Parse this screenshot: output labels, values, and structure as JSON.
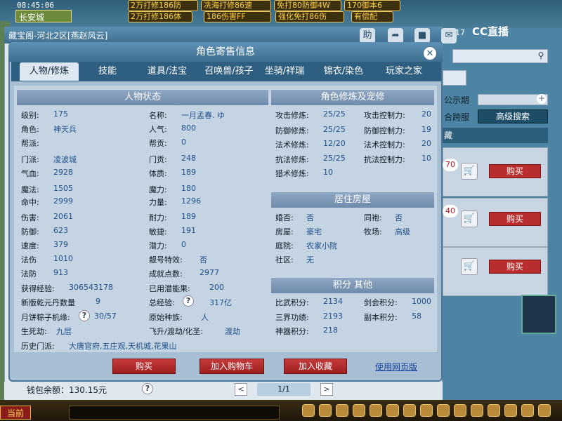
{
  "game": {
    "clock": "08:45:06",
    "location": "长安城",
    "top_buttons": [
      "2万打修186防",
      "冼海打修86速",
      "免打80防御4W",
      "170御本6",
      "2万打修186体",
      "186伤害FF",
      "强化免打86伤",
      "有偿配"
    ]
  },
  "window": {
    "title": "藏宝阁-河北2区[燕赵风云]",
    "toolbar_icons": [
      "help-icon",
      "share-icon",
      "stop-icon",
      "chat-icon"
    ],
    "notification_count": "17",
    "cc_logo": "CC直播"
  },
  "right_panel": {
    "public_label": "公示期",
    "cross_label": "合跨服",
    "adv_search": "高级搜索",
    "tab_label": "藏",
    "items": [
      {
        "price": "70",
        "buy": "购买"
      },
      {
        "price": "40",
        "buy": "购买"
      },
      {
        "price": "",
        "buy": "购买"
      }
    ]
  },
  "dialog": {
    "title": "角色寄售信息",
    "tabs": [
      "人物/修炼",
      "技能",
      "道具/法宝",
      "召唤兽/孩子",
      "坐骑/祥瑞",
      "锦衣/染色",
      "玩家之家"
    ],
    "active_tab": 0
  },
  "status": {
    "header": "人物状态",
    "col1": [
      {
        "label": "级别:",
        "value": "175"
      },
      {
        "label": "角色:",
        "value": "神天兵"
      },
      {
        "label": "帮派:",
        "value": ""
      },
      {
        "label": "门派:",
        "value": "凌波城"
      },
      {
        "label": "气血:",
        "value": "2928"
      },
      {
        "label": "魔法:",
        "value": "1505"
      },
      {
        "label": "命中:",
        "value": "2999"
      },
      {
        "label": "伤害:",
        "value": "2061"
      },
      {
        "label": "防御:",
        "value": "623"
      },
      {
        "label": "速度:",
        "value": "379"
      },
      {
        "label": "法伤",
        "value": "1010"
      },
      {
        "label": "法防",
        "value": "913"
      }
    ],
    "col2": [
      {
        "label": "名称:",
        "value": "一月孟春. ゆ"
      },
      {
        "label": "人气:",
        "value": "800"
      },
      {
        "label": "帮贡:",
        "value": "0"
      },
      {
        "label": "门贡:",
        "value": "248"
      },
      {
        "label": "体质:",
        "value": "189"
      },
      {
        "label": "魔力:",
        "value": "180"
      },
      {
        "label": "力量:",
        "value": "1296"
      },
      {
        "label": "耐力:",
        "value": "189"
      },
      {
        "label": "敏捷:",
        "value": "191"
      },
      {
        "label": "潜力:",
        "value": "0"
      },
      {
        "label": "靓号特效:",
        "value": "否"
      },
      {
        "label": "成就点数:",
        "value": "2977"
      }
    ],
    "exp_label": "获得经验:",
    "exp_value": "306543178",
    "potential_used_label": "已用潜能果:",
    "potential_used_value": "200",
    "qianyuan_label": "新版乾元丹数量",
    "qianyuan_value": "9",
    "total_exp_label": "总经验:",
    "total_exp_value": "317亿",
    "mooncake_label": "月饼粽子机缘:",
    "mooncake_value": "30/57",
    "race_label": "原始种族:",
    "race_value": "人",
    "life_death_label": "生死劫:",
    "life_death_value": "九层",
    "feisheng_label": "飞升/渡劫/化圣:",
    "feisheng_value": "渡劫",
    "history_label": "历史门派:",
    "history_value": "大唐官府,五庄观,天机城,花果山"
  },
  "cultivation": {
    "header": "角色修炼及宠修",
    "col1": [
      {
        "label": "攻击修炼:",
        "value": "25/25"
      },
      {
        "label": "防御修炼:",
        "value": "25/25"
      },
      {
        "label": "法术修炼:",
        "value": "12/20"
      },
      {
        "label": "抗法修炼:",
        "value": "25/25"
      },
      {
        "label": "猎术修炼:",
        "value": "10"
      }
    ],
    "col2": [
      {
        "label": "攻击控制力:",
        "value": "20"
      },
      {
        "label": "防御控制力:",
        "value": "19"
      },
      {
        "label": "法术控制力:",
        "value": "20"
      },
      {
        "label": "抗法控制力:",
        "value": "10"
      }
    ]
  },
  "house": {
    "header": "居住房屋",
    "married_label": "婚否:",
    "married_value": "否",
    "sworn_label": "同袍:",
    "sworn_value": "否",
    "house_label": "房屋:",
    "house_value": "豪宅",
    "ranch_label": "牧场:",
    "ranch_value": "高级",
    "yard_label": "庭院:",
    "yard_value": "农家小院",
    "community_label": "社区:",
    "community_value": "无"
  },
  "score": {
    "header": "积分 其他",
    "pvp_label": "比武积分:",
    "pvp_value": "2134",
    "sword_label": "剑会积分:",
    "sword_value": "1000",
    "realm_label": "三界功绩:",
    "realm_value": "2193",
    "dungeon_label": "副本积分:",
    "dungeon_value": "58",
    "weapon_label": "神器积分:",
    "weapon_value": "218"
  },
  "actions": {
    "buy": "购买",
    "add_cart": "加入购物车",
    "add_fav": "加入收藏",
    "web_link": "使用网页版"
  },
  "footer": {
    "wallet": "钱包余额：130.15元",
    "prev": "<",
    "page": "1/1",
    "next": ">"
  },
  "taskbar": {
    "current": "当前"
  }
}
